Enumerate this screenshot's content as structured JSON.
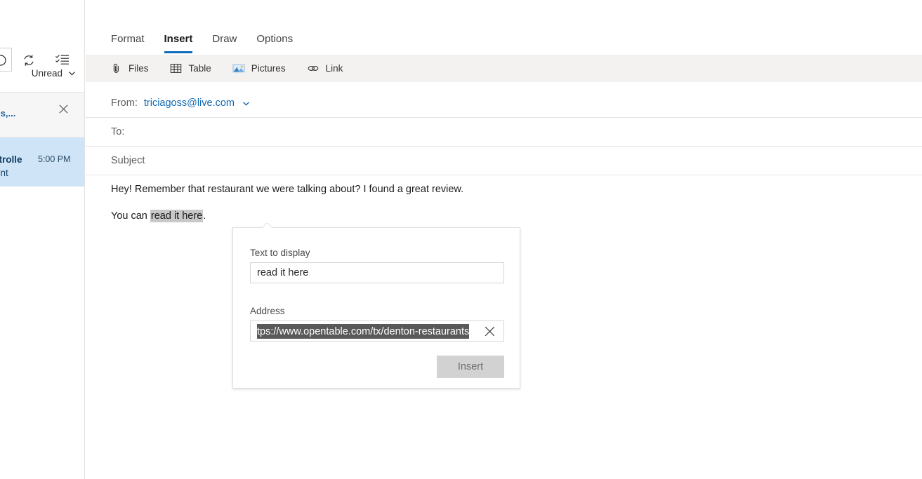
{
  "left_panel": {
    "toolbar_icons": [
      {
        "name": "undo-icon"
      },
      {
        "name": "sync-icon"
      },
      {
        "name": "tasks-checklist-icon"
      }
    ],
    "filter": {
      "label": "Unread",
      "chevron_icon": "chevron-down-icon"
    },
    "messages": [
      {
        "type": "ad",
        "sender": "hl's,...",
        "close_icon": "close-icon"
      },
      {
        "type": "email",
        "sender": "ontrolle",
        "time": "5:00 PM",
        "preview": "tment",
        "selected": true
      }
    ]
  },
  "compose": {
    "tabs": [
      {
        "label": "Format",
        "active": false
      },
      {
        "label": "Insert",
        "active": true
      },
      {
        "label": "Draw",
        "active": false
      },
      {
        "label": "Options",
        "active": false
      }
    ],
    "ribbon": [
      {
        "label": "Files",
        "icon": "attachment-paperclip-icon"
      },
      {
        "label": "Table",
        "icon": "table-grid-icon"
      },
      {
        "label": "Pictures",
        "icon": "picture-image-icon"
      },
      {
        "label": "Link",
        "icon": "chain-link-icon"
      }
    ],
    "fields": {
      "from_label": "From:",
      "from_address": "triciagoss@live.com",
      "from_chevron_icon": "chevron-down-icon",
      "to_label": "To:",
      "subject_placeholder": "Subject"
    },
    "body": {
      "line1": "Hey! Remember that restaurant we were talking about? I found a great review.",
      "line2_prefix": "You can ",
      "line2_selected": "read it here",
      "line2_suffix": "."
    }
  },
  "link_dialog": {
    "text_to_display_label": "Text to display",
    "text_to_display_value": "read it here",
    "address_label": "Address",
    "address_value": "ttps://www.opentable.com/tx/denton-restaurants",
    "address_clear_icon": "clear-x-icon",
    "insert_button": "Insert"
  },
  "colors": {
    "accent_blue": "#0f6cbd",
    "link_blue": "#1168b3",
    "ribbon_bg": "#f3f2f1",
    "selected_row": "#cfe4f7",
    "text_selection": "#c8c8c8",
    "input_selection": "#595959",
    "disabled_button": "#d2d2d2"
  }
}
